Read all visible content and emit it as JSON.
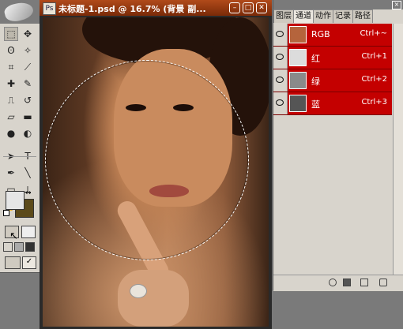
{
  "document": {
    "title": "未标题-1.psd @ 16.7% (背景 副..."
  },
  "panel": {
    "tabs": [
      "图层",
      "通道",
      "动作",
      "记录",
      "路径"
    ],
    "active_tab": "通道",
    "channels": [
      {
        "name": "RGB",
        "shortcut": "Ctrl+~"
      },
      {
        "name": "红",
        "shortcut": "Ctrl+1"
      },
      {
        "name": "绿",
        "shortcut": "Ctrl+2"
      },
      {
        "name": "蓝",
        "shortcut": "Ctrl+3"
      }
    ]
  },
  "toolbox": {
    "tool_icons": [
      "marquee-icon",
      "move-icon",
      "lasso-icon",
      "magic-wand-icon",
      "crop-icon",
      "slice-icon",
      "healing-brush-icon",
      "brush-icon",
      "clone-stamp-icon",
      "history-brush-icon",
      "eraser-icon",
      "gradient-icon",
      "blur-icon",
      "dodge-icon",
      "path-selection-icon",
      "type-icon",
      "pen-icon",
      "line-icon",
      "notes-icon",
      "eyedropper-icon",
      "hand-icon",
      "zoom-icon"
    ],
    "foreground_color": "#e6e6e6",
    "background_color": "#5c4a1a"
  },
  "colors": {
    "title_bar": "#9a3b12",
    "channel_highlight": "#c40000"
  }
}
